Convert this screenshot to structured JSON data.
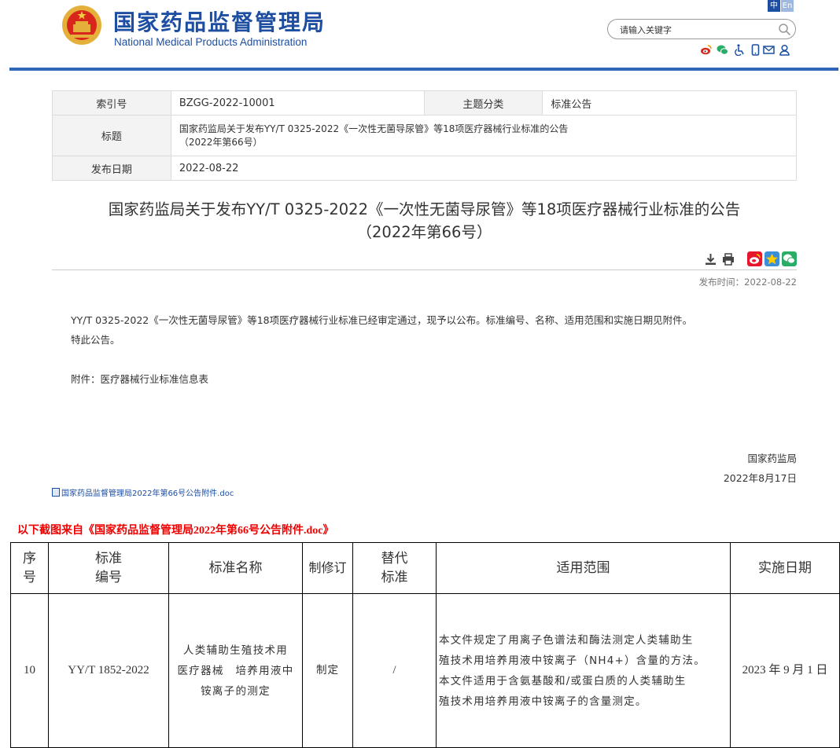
{
  "header": {
    "site_name_cn": "国家药品监督管理局",
    "site_name_en": "National Medical Products Administration",
    "lang_zh": "中",
    "lang_en": "En",
    "search_placeholder": "请输入关键字",
    "tool_icons": [
      "weibo-icon",
      "wechat-icon",
      "accessibility-icon",
      "mobile-icon",
      "mail-icon",
      "user-icon"
    ],
    "accent_color": "#1d4ea2"
  },
  "info_table": {
    "index_label": "索引号",
    "index_value": "BZGG-2022-10001",
    "category_label": "主题分类",
    "category_value": "标准公告",
    "title_label": "标题",
    "title_value_line1": "国家药监局关于发布YY/T 0325-2022《一次性无菌导尿管》等18项医疗器械行业标准的公告",
    "title_value_line2": "（2022年第66号）",
    "date_label": "发布日期",
    "date_value": "2022-08-22"
  },
  "article": {
    "title_line1": "国家药监局关于发布YY/T 0325-2022《一次性无菌导尿管》等18项医疗器械行业标准的公告",
    "title_line2": "（2022年第66号）",
    "publish_time": "发布时间：2022-08-22",
    "paragraph1": "YY/T 0325-2022《一次性无菌导尿管》等18项医疗器械行业标准已经审定通过，现予以公布。标准编号、名称、适用范围和实施日期见附件。",
    "paragraph2": "特此公告。",
    "attachment_note": "附件：医疗器械行业标准信息表",
    "signature": "国家药监局",
    "sign_date": "2022年8月17日",
    "doc_link": "国家药品监督管理局2022年第66号公告附件.doc"
  },
  "note": "以下截图来自《国家药品监督管理局2022年第66号公告附件.doc》",
  "standards_table": {
    "headers": {
      "seq": [
        "序",
        "号"
      ],
      "std_no": [
        "标准",
        "编号"
      ],
      "name": "标准名称",
      "revision": "制修订",
      "replace": [
        "替代",
        "标准"
      ],
      "scope": "适用范围",
      "date": "实施日期"
    },
    "rows": [
      {
        "seq": "10",
        "std_no": "YY/T 1852-2022",
        "name": [
          "人类辅助生殖技术用",
          "医疗器械　培养用液中",
          "铵离子的测定"
        ],
        "revision": "制定",
        "replace": "/",
        "scope": [
          "本文件规定了用离子色谱法和酶法测定人类辅助生",
          "殖技术用培养用液中铵离子（NH4+）含量的方法。",
          "本文件适用于含氨基酸和/或蛋白质的人类辅助生",
          "殖技术用培养用液中铵离子的含量测定。"
        ],
        "date": "2023 年 9 月 1 日"
      }
    ]
  }
}
